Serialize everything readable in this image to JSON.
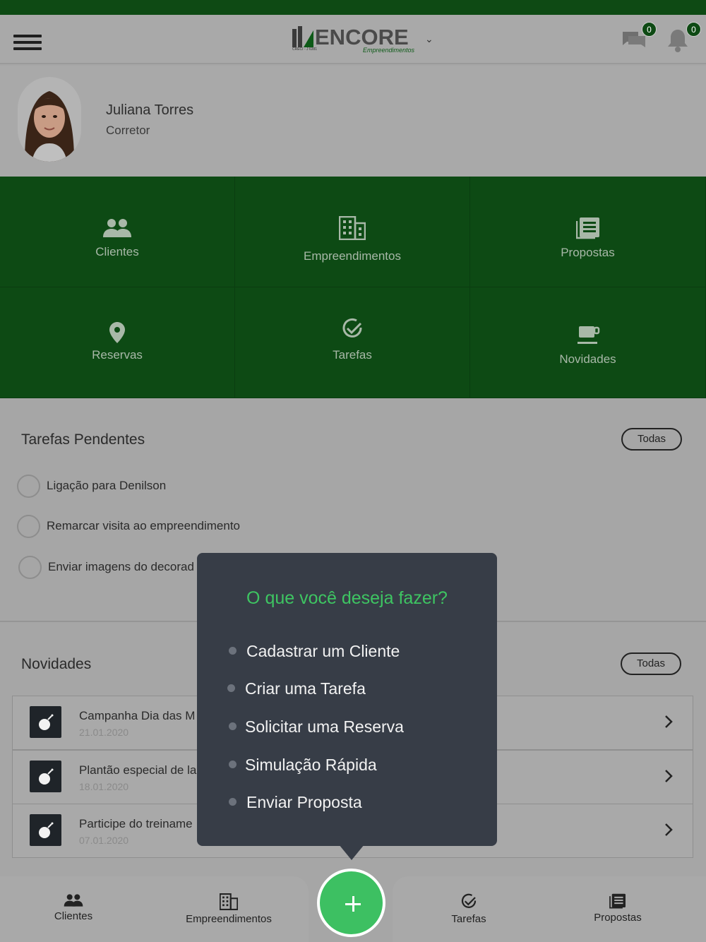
{
  "header": {
    "brand": "ENCORE",
    "brand_sub": "Empreendimentos",
    "creci": "CRECI - J 6381",
    "messages_count": "0",
    "notifications_count": "0"
  },
  "profile": {
    "name": "Juliana Torres",
    "role": "Corretor"
  },
  "grid": [
    {
      "label": "Clientes",
      "icon": "people-icon"
    },
    {
      "label": "Empreendimentos",
      "icon": "building-icon"
    },
    {
      "label": "Propostas",
      "icon": "list-icon"
    },
    {
      "label": "Reservas",
      "icon": "location-pin-icon"
    },
    {
      "label": "Tarefas",
      "icon": "check-circle-icon"
    },
    {
      "label": "Novidades",
      "icon": "coffee-icon"
    }
  ],
  "tasks": {
    "title": "Tarefas Pendentes",
    "all_label": "Todas",
    "items": [
      "Ligação para Denilson",
      "Remarcar visita ao empreendimento",
      "Enviar imagens do decorad"
    ]
  },
  "news": {
    "title": "Novidades",
    "all_label": "Todas",
    "items": [
      {
        "title": "Campanha Dia das M",
        "date": "21.01.2020"
      },
      {
        "title": "Plantão especial de la",
        "date": "18.01.2020"
      },
      {
        "title": "Participe do treiname",
        "date": "07.01.2020"
      }
    ]
  },
  "popup": {
    "title": "O que você deseja fazer?",
    "items": [
      "Cadastrar um Cliente",
      "Criar uma Tarefa",
      "Solicitar uma Reserva",
      "Simulação Rápida",
      "Enviar Proposta"
    ]
  },
  "bottom_nav": [
    {
      "label": "Clientes"
    },
    {
      "label": "Empreendimentos"
    },
    {
      "label": "Tarefas"
    },
    {
      "label": "Propostas"
    }
  ]
}
